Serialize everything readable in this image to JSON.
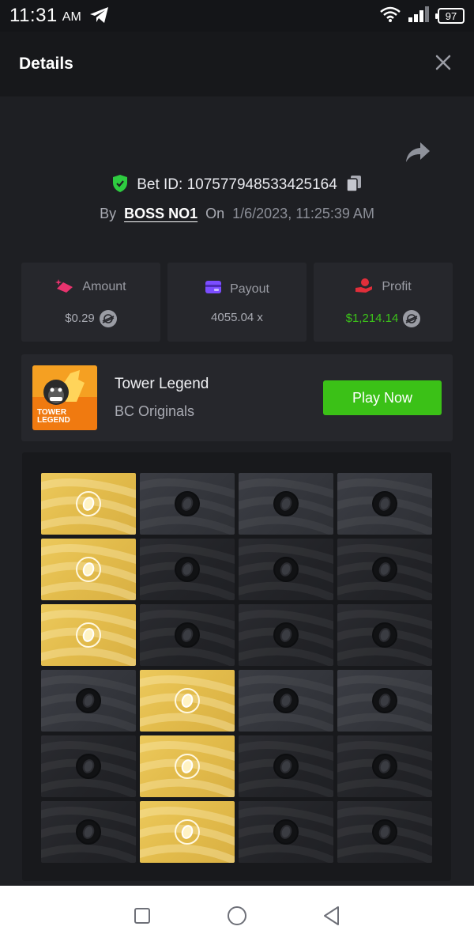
{
  "status_bar": {
    "time": "11:31",
    "ampm": "AM",
    "battery": "97"
  },
  "header": {
    "title": "Details"
  },
  "bet": {
    "id_label": "Bet ID: 107577948533425164",
    "by_label": "By",
    "user": "BOSS NO1",
    "on_label": "On",
    "date": "1/6/2023, 11:25:39 AM"
  },
  "stats": {
    "amount_label": "Amount",
    "amount_value": "$0.29",
    "payout_label": "Payout",
    "payout_value": "4055.04 x",
    "profit_label": "Profit",
    "profit_value": "$1,214.14"
  },
  "game": {
    "name": "Tower Legend",
    "provider": "BC Originals",
    "thumb_text_1": "TOWER",
    "thumb_text_2": "LEGEND",
    "play_label": "Play Now"
  },
  "board": {
    "rows": [
      [
        "gold",
        "grey",
        "grey",
        "grey"
      ],
      [
        "gold",
        "dark",
        "dark",
        "dark"
      ],
      [
        "gold",
        "dark",
        "dark",
        "dark"
      ],
      [
        "grey",
        "gold",
        "grey",
        "grey"
      ],
      [
        "dark",
        "gold",
        "dark",
        "dark"
      ],
      [
        "dark",
        "gold",
        "dark",
        "dark"
      ]
    ]
  },
  "colors": {
    "background": "#1e1f23",
    "card": "#26272c",
    "accent_green": "#3bc117",
    "profit_green": "#3cc21a",
    "gold_tile": "#e2bb4b",
    "amount_icon": "#e8336e",
    "payout_icon": "#7b4dff",
    "profit_icon": "#e02e3a",
    "shield_green": "#2ecc40"
  },
  "icons": {
    "telegram": "telegram-icon",
    "wifi": "wifi-icon",
    "signal": "signal-icon",
    "close": "close-icon",
    "share": "share-icon",
    "shield": "shield-check-icon",
    "copy": "copy-icon",
    "coin": "stellar-coin-icon",
    "egg": "egg-icon"
  }
}
